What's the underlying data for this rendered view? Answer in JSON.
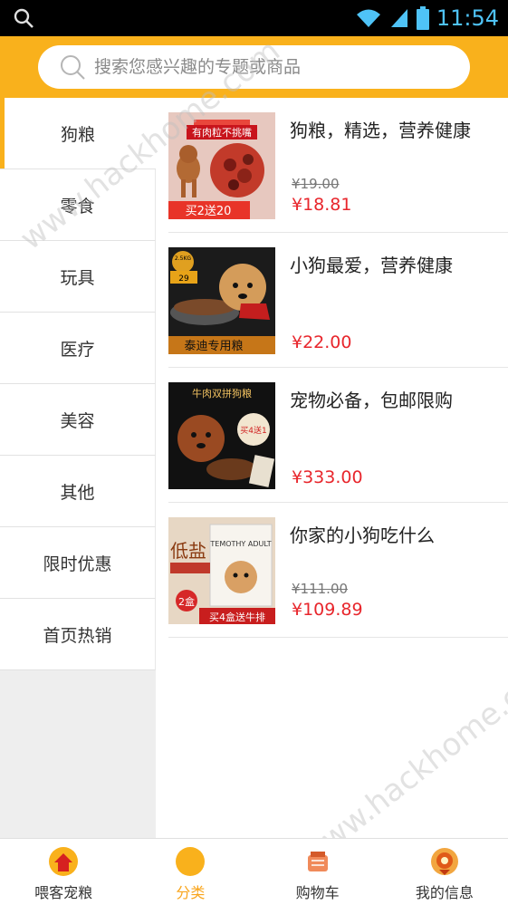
{
  "status_bar": {
    "time": "11:54"
  },
  "search": {
    "placeholder": "搜索您感兴趣的专题或商品"
  },
  "sidebar": {
    "items": [
      {
        "label": "狗粮",
        "active": true
      },
      {
        "label": "零食"
      },
      {
        "label": "玩具"
      },
      {
        "label": "医疗"
      },
      {
        "label": "美容"
      },
      {
        "label": "其他"
      },
      {
        "label": "限时优惠"
      },
      {
        "label": "首页热销"
      }
    ]
  },
  "products": [
    {
      "title": "狗粮，精选，营养健康",
      "old_price": "¥19.00",
      "price": "¥18.81",
      "image_texts": [
        "有肉粒不挑嘴",
        "买2送20"
      ]
    },
    {
      "title": "小狗最爱，营养健康",
      "price": "¥22.00",
      "image_texts": [
        "2.5KG",
        "29",
        "泰迪专用粮"
      ]
    },
    {
      "title": "宠物必备，包邮限购",
      "price": "¥333.00",
      "image_texts": [
        "牛肉双拼狗粮",
        "买4送1"
      ]
    },
    {
      "title": "你家的小狗吃什么",
      "old_price": "¥111.00",
      "price": "¥109.89",
      "image_texts": [
        "低盐",
        "TEMOTHY ADULT",
        "2盒",
        "买4盒送牛排"
      ]
    }
  ],
  "bottom_nav": {
    "items": [
      {
        "label": "喂客宠粮",
        "icon": "home-icon"
      },
      {
        "label": "分类",
        "icon": "category-icon",
        "active": true
      },
      {
        "label": "购物车",
        "icon": "cart-icon"
      },
      {
        "label": "我的信息",
        "icon": "profile-icon"
      }
    ]
  },
  "watermarks": [
    "www.hackhome.com",
    "www.hackhome.com"
  ],
  "colors": {
    "accent": "#f9b11c",
    "price": "#e8262c"
  }
}
